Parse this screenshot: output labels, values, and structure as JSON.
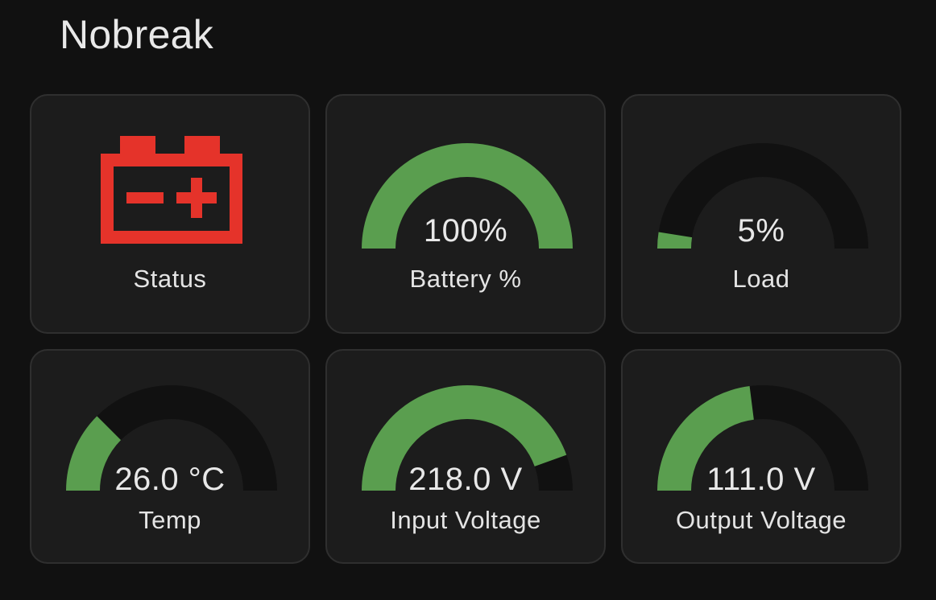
{
  "page": {
    "title": "Nobreak"
  },
  "colors": {
    "background": "#111111",
    "card": "#1c1c1c",
    "gauge_fill": "#5a9e4f",
    "gauge_track": "#111111",
    "alert": "#e5332a"
  },
  "cards": [
    {
      "id": "status",
      "name": "Status",
      "icon": "battery-alert-icon"
    },
    {
      "id": "battery",
      "name": "Battery %",
      "value_text": "100%",
      "fraction": 1.0
    },
    {
      "id": "load",
      "name": "Load",
      "value_text": "5%",
      "fraction": 0.05
    },
    {
      "id": "temp",
      "name": "Temp",
      "value_text": "26.0 °C",
      "fraction": 0.25
    },
    {
      "id": "input_voltage",
      "name": "Input Voltage",
      "value_text": "218.0 V",
      "fraction": 0.89
    },
    {
      "id": "output_voltage",
      "name": "Output Voltage",
      "value_text": "111.0 V",
      "fraction": 0.46
    }
  ]
}
